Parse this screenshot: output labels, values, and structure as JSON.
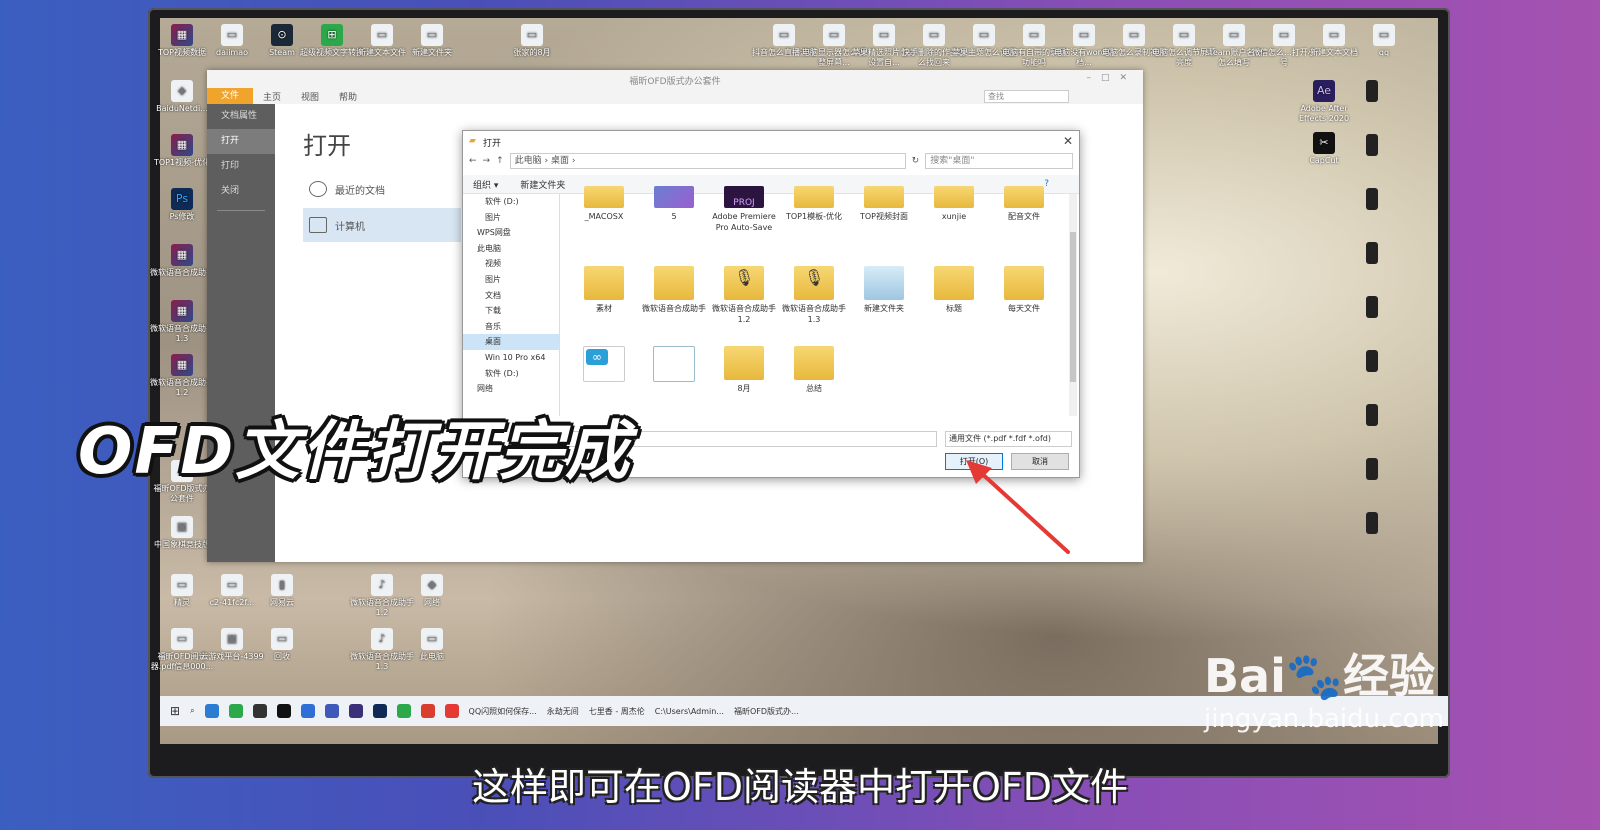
{
  "desktop": {
    "top_icons": [
      {
        "label": "TOP视频数据",
        "glyph": "▦",
        "cls": "rar"
      },
      {
        "label": "daiimao",
        "glyph": "▭",
        "cls": "file"
      },
      {
        "label": "Steam",
        "glyph": "⊙",
        "cls": "steam"
      },
      {
        "label": "超级视频文字转换",
        "glyph": "⊞",
        "cls": "green"
      },
      {
        "label": "新建文本文件",
        "glyph": "▭",
        "cls": "file"
      },
      {
        "label": "新建文件夹",
        "glyph": "▭",
        "cls": "file"
      },
      {
        "label": "张家的8月",
        "glyph": "▭",
        "cls": "file"
      },
      {
        "label": "抖音怎么直播游戏",
        "glyph": "▭",
        "cls": "file"
      },
      {
        "label": "电脑显示器怎么调整屏幕...",
        "glyph": "▭",
        "cls": "file"
      },
      {
        "label": "苹果精选照片怎么设置自...",
        "glyph": "▭",
        "cls": "file"
      },
      {
        "label": "快手删除的作品怎么找回来",
        "glyph": "▭",
        "cls": "file"
      },
      {
        "label": "苹果主题怎么设置",
        "glyph": "▭",
        "cls": "file"
      },
      {
        "label": "电脑有自带的录屏功能吗",
        "glyph": "▭",
        "cls": "file"
      },
      {
        "label": "电脑没有word文档...",
        "glyph": "▭",
        "cls": "file"
      },
      {
        "label": "电脑怎么录制视频",
        "glyph": "▭",
        "cls": "file"
      },
      {
        "label": "电脑怎么调节屏幕亮度",
        "glyph": "▭",
        "cls": "file"
      },
      {
        "label": "steam账户名称怎么填写",
        "glyph": "▭",
        "cls": "file"
      },
      {
        "label": "微信怎么...打开小号",
        "glyph": "▭",
        "cls": "file"
      },
      {
        "label": "新建文本文档",
        "glyph": "▭",
        "cls": "file"
      },
      {
        "label": "qq",
        "glyph": "▭",
        "cls": "file"
      }
    ],
    "left_icons": [
      {
        "label": "BaiduNetdi...",
        "glyph": "◈",
        "cls": "file"
      },
      {
        "label": "TOP1视频-优化",
        "glyph": "▦",
        "cls": "rar"
      },
      {
        "label": "Ps修改",
        "glyph": "Ps",
        "cls": "ps"
      },
      {
        "label": "微软语音合成助手",
        "glyph": "▦",
        "cls": "rar"
      },
      {
        "label": "微软语音合成助手1.3",
        "glyph": "▦",
        "cls": "rar"
      },
      {
        "label": "微软语音合成助手1.2",
        "glyph": "▦",
        "cls": "rar"
      },
      {
        "label": "福昕OFD版式办公套件",
        "glyph": "⚠",
        "cls": "file"
      },
      {
        "label": "中国象棋竞技版",
        "glyph": "▣",
        "cls": "file"
      }
    ],
    "right_icons": [
      {
        "label": "Adobe After Effects 2020",
        "glyph": "Ae",
        "cls": "ae"
      },
      {
        "label": "CapCut",
        "glyph": "✂",
        "cls": "cap"
      }
    ],
    "bottom_icons": [
      {
        "label": "精灵",
        "glyph": "▭",
        "cls": "file"
      },
      {
        "label": "c2-41fc2f...",
        "glyph": "▭",
        "cls": "file"
      },
      {
        "label": "网易云",
        "glyph": "▮",
        "cls": "file"
      },
      {
        "label": "微软语音合成助手1.2",
        "glyph": "♪",
        "cls": "file"
      },
      {
        "label": "网络",
        "glyph": "◆",
        "cls": "file"
      },
      {
        "label": "福昕OFD阅读器.pdf信息000...",
        "glyph": "▭",
        "cls": "file"
      },
      {
        "label": "云游戏平台-4399",
        "glyph": "▣",
        "cls": "file"
      },
      {
        "label": "回收",
        "glyph": "▭",
        "cls": "file"
      },
      {
        "label": "微软语音合成助手1.3",
        "glyph": "♪",
        "cls": "file"
      },
      {
        "label": "此电脑",
        "glyph": "▭",
        "cls": "file"
      }
    ]
  },
  "app": {
    "title": "福昕OFD版式办公套件",
    "menu": [
      "文件",
      "主页",
      "视图",
      "帮助"
    ],
    "search_placeholder": "查找",
    "nav": [
      "文档属性",
      "打开",
      "打印",
      "关闭"
    ],
    "open_heading": "打开",
    "options": [
      "最近的文档",
      "计算机"
    ]
  },
  "dialog": {
    "title": "打开",
    "breadcrumb": "此电脑 › 桌面 ›",
    "search_placeholder": "搜索\"桌面\"",
    "toolbar": [
      "组织 ▾",
      "新建文件夹"
    ],
    "tree": [
      {
        "label": "软件 (D:)",
        "sel": false
      },
      {
        "label": "图片",
        "sel": false
      },
      {
        "label": "WPS网盘",
        "sel": false,
        "top": true
      },
      {
        "label": "此电脑",
        "sel": false,
        "top": true
      },
      {
        "label": "视频",
        "sel": false
      },
      {
        "label": "图片",
        "sel": false
      },
      {
        "label": "文档",
        "sel": false
      },
      {
        "label": "下载",
        "sel": false
      },
      {
        "label": "音乐",
        "sel": false
      },
      {
        "label": "桌面",
        "sel": true
      },
      {
        "label": "Win 10 Pro x64",
        "sel": false
      },
      {
        "label": "软件 (D:)",
        "sel": false
      },
      {
        "label": "网络",
        "sel": false,
        "top": true
      }
    ],
    "files": [
      {
        "name": "_MACOSX",
        "kind": "folder",
        "row": 0
      },
      {
        "name": "5",
        "kind": "cloud",
        "row": 0
      },
      {
        "name": "Adobe Premiere Pro Auto-Save",
        "kind": "pr",
        "row": 0
      },
      {
        "name": "TOP1模板-优化",
        "kind": "folder",
        "row": 0
      },
      {
        "name": "TOP视频封面",
        "kind": "folder",
        "row": 0
      },
      {
        "name": "xunjie",
        "kind": "folder",
        "row": 0
      },
      {
        "name": "配音文件",
        "kind": "folder",
        "row": 0
      },
      {
        "name": "素材",
        "kind": "folder",
        "row": 1
      },
      {
        "name": "微软语音合成助手",
        "kind": "folder",
        "row": 1
      },
      {
        "name": "微软语音合成助手1.2",
        "kind": "mic",
        "row": 1
      },
      {
        "name": "微软语音合成助手1.3",
        "kind": "mic",
        "row": 1
      },
      {
        "name": "新建文件夹",
        "kind": "doc",
        "row": 1
      },
      {
        "name": "标题",
        "kind": "folder",
        "row": 1
      },
      {
        "name": "每天文件",
        "kind": "folder",
        "row": 1
      },
      {
        "name": "",
        "kind": "ofd",
        "row": 2
      },
      {
        "name": "",
        "kind": "blank",
        "row": 2
      },
      {
        "name": "8月",
        "kind": "folder",
        "row": 2
      },
      {
        "name": "总结",
        "kind": "folder",
        "row": 2
      }
    ],
    "file_type": "通用文件 (*.pdf *.fdf *.ofd)",
    "open_label": "打开(O)",
    "cancel_label": "取消"
  },
  "taskbar": {
    "items": [
      "QQ闪照如何保存...",
      "永劫无间",
      "七里香 - 周杰伦",
      "C:\\Users\\Admin...",
      "福昕OFD版式办..."
    ]
  },
  "overlay": {
    "title": "OFD文件打开完成",
    "subtitle": "这样即可在OFD阅读器中打开OFD文件"
  },
  "watermark": {
    "logo": "Bai",
    "logo_tail": "经验",
    "url": "jingyan.baidu.com"
  },
  "colors": {
    "accent": "#f0a42c",
    "selection": "#cce4f7",
    "arrow": "#e53935"
  }
}
